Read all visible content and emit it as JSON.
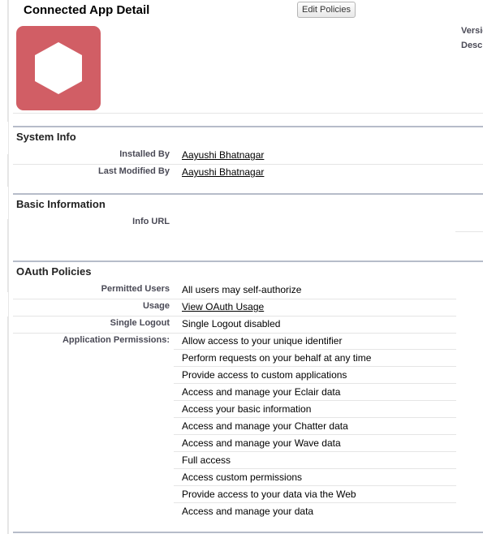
{
  "header": {
    "title": "Connected App Detail",
    "edit_button": "Edit Policies",
    "version_label": "Versio",
    "description_label": "Descr"
  },
  "sections": {
    "system_info": {
      "title": "System Info",
      "installed_by_label": "Installed By",
      "installed_by_value": "Aayushi Bhatnagar",
      "modified_by_label": "Last Modified By",
      "modified_by_value": "Aayushi Bhatnagar"
    },
    "basic_info": {
      "title": "Basic Information",
      "info_url_label": "Info URL"
    },
    "oauth": {
      "title": "OAuth Policies",
      "permitted_users_label": "Permitted Users",
      "permitted_users_value": "All users may self-authorize",
      "usage_label": "Usage",
      "usage_value": "View OAuth Usage",
      "single_logout_label": "Single Logout",
      "single_logout_value": "Single Logout disabled",
      "permissions_label": "Application Permissions:",
      "permissions": [
        "Allow access to your unique identifier",
        "Perform requests on your behalf at any time",
        "Provide access to custom applications",
        "Access and manage your Eclair data",
        "Access your basic information",
        "Access and manage your Chatter data",
        "Access and manage your Wave data",
        "Full access",
        "Access custom permissions",
        "Provide access to your data via the Web",
        "Access and manage your data"
      ]
    }
  },
  "colors": {
    "logo_bg": "#d15e65",
    "section_line": "#b6bcc9"
  }
}
